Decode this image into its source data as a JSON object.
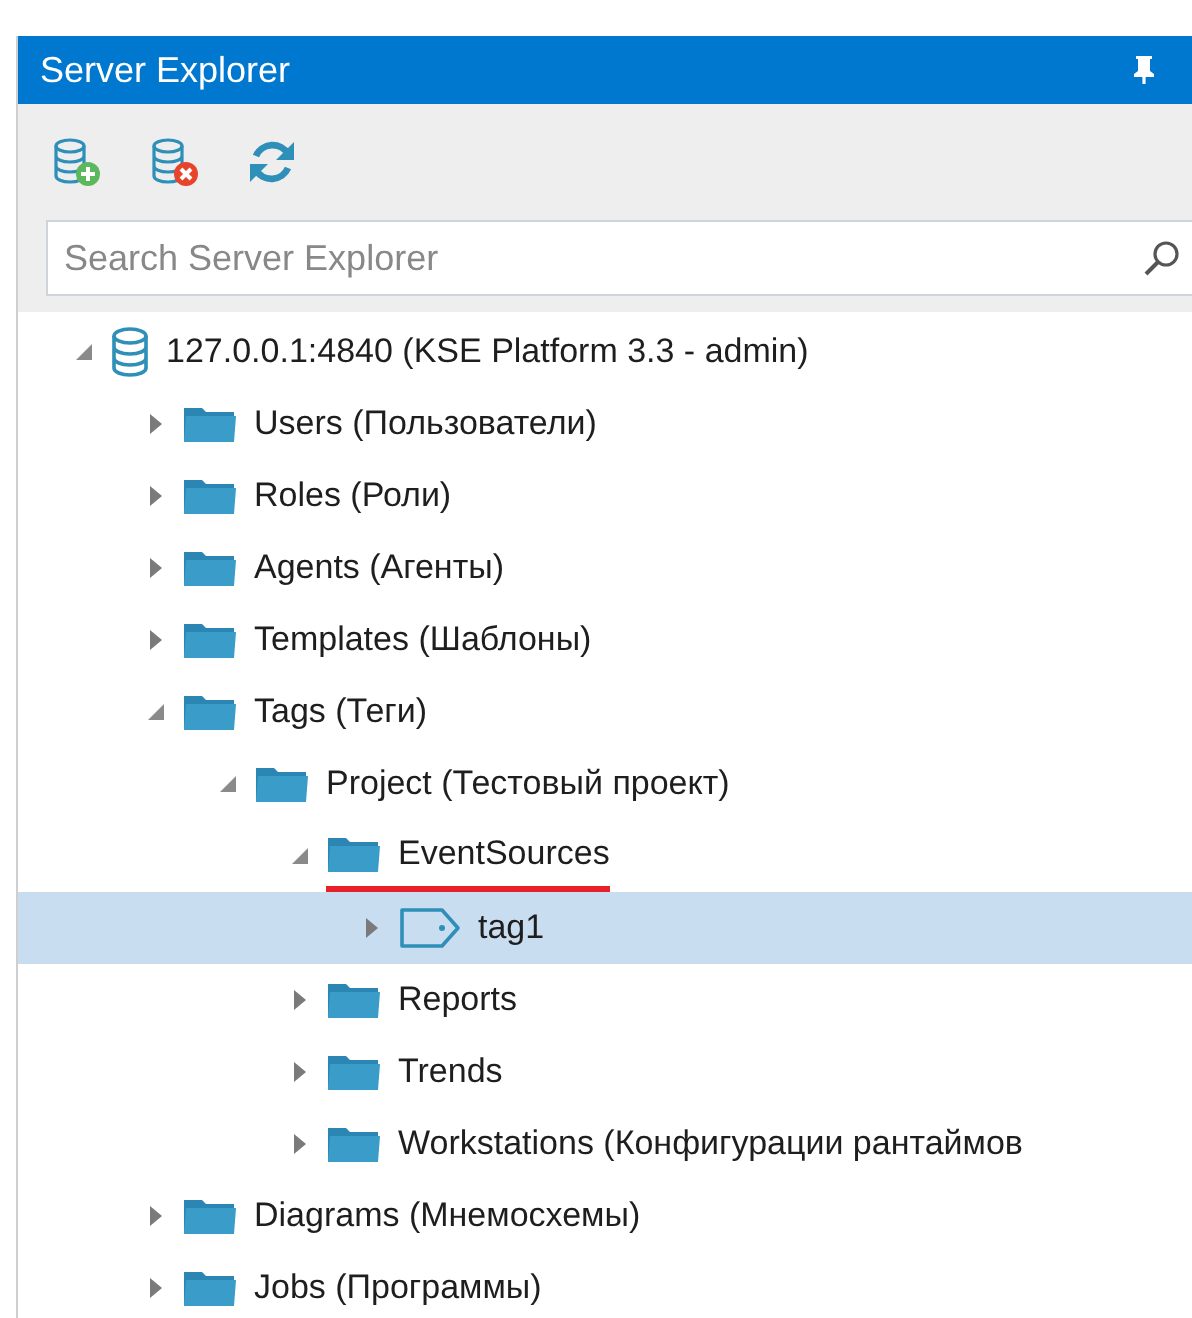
{
  "panel": {
    "title": "Server Explorer"
  },
  "toolbar": {
    "buttons": [
      {
        "kind": "add-server"
      },
      {
        "kind": "remove-server"
      },
      {
        "kind": "refresh"
      }
    ]
  },
  "search": {
    "placeholder": "Search Server Explorer"
  },
  "tree": [
    {
      "label": "127.0.0.1:4840 (KSE Platform 3.3 - admin)",
      "kind": "server",
      "expanded": true,
      "selected": false,
      "underlined": false,
      "children": [
        {
          "label": "Users (Пользователи)",
          "kind": "folder",
          "expanded": false,
          "selected": false,
          "underlined": false
        },
        {
          "label": "Roles (Роли)",
          "kind": "folder",
          "expanded": false,
          "selected": false,
          "underlined": false
        },
        {
          "label": "Agents (Агенты)",
          "kind": "folder",
          "expanded": false,
          "selected": false,
          "underlined": false
        },
        {
          "label": "Templates (Шаблоны)",
          "kind": "folder",
          "expanded": false,
          "selected": false,
          "underlined": false
        },
        {
          "label": "Tags (Теги)",
          "kind": "folder",
          "expanded": true,
          "selected": false,
          "underlined": false,
          "children": [
            {
              "label": "Project (Тестовый проект)",
              "kind": "folder",
              "expanded": true,
              "selected": false,
              "underlined": false,
              "children": [
                {
                  "label": "EventSources",
                  "kind": "folder",
                  "expanded": true,
                  "selected": false,
                  "underlined": true,
                  "children": [
                    {
                      "label": "tag1",
                      "kind": "tag",
                      "expanded": false,
                      "selected": true,
                      "underlined": false
                    }
                  ]
                },
                {
                  "label": "Reports",
                  "kind": "folder",
                  "expanded": false,
                  "selected": false,
                  "underlined": false
                },
                {
                  "label": "Trends",
                  "kind": "folder",
                  "expanded": false,
                  "selected": false,
                  "underlined": false
                },
                {
                  "label": "Workstations (Конфигурации рантаймов",
                  "kind": "folder",
                  "expanded": false,
                  "selected": false,
                  "underlined": false
                }
              ]
            }
          ]
        },
        {
          "label": "Diagrams (Мнемосхемы)",
          "kind": "folder",
          "expanded": false,
          "selected": false,
          "underlined": false
        },
        {
          "label": "Jobs (Программы)",
          "kind": "folder",
          "expanded": false,
          "selected": false,
          "underlined": false
        }
      ]
    }
  ]
}
